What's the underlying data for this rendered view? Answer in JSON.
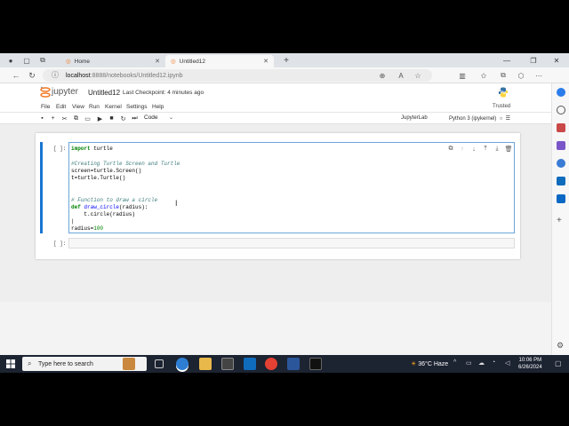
{
  "browser": {
    "tabs": [
      {
        "label": "Home",
        "active": false
      },
      {
        "label": "Untitled12",
        "active": true
      }
    ],
    "new_tab": "+",
    "url_host": "localhost",
    "url_path": ":8888/notebooks/Untitled12.ipynb"
  },
  "jupyter": {
    "brand": "jupyter",
    "notebook_name": "Untitled12",
    "checkpoint": "Last Checkpoint: 4 minutes ago",
    "trusted": "Trusted",
    "menus": [
      "File",
      "Edit",
      "View",
      "Run",
      "Kernel",
      "Settings",
      "Help"
    ],
    "cell_type": "Code",
    "jupyterlab_link": "JupyterLab",
    "kernel_name": "Python 3 (ipykernel)"
  },
  "cells": {
    "cell1_prompt": "[ ]:",
    "cell2_prompt": "[ ]:",
    "code": {
      "l1_kw": "import",
      "l1_rest": " turtle",
      "l3": "#Creating Turtle Screen and Turtle",
      "l4": "screen=turtle.Screen()",
      "l5": "t=turtle.Turtle()",
      "l8": "# Function to draw a circle",
      "l9_kw": "def",
      "l9_fn": " draw_circle",
      "l9_rest": "(radius):",
      "l10": "    t.circle(radius)",
      "l11": "|",
      "l12_a": "radius=",
      "l12_b": "100"
    }
  },
  "taskbar": {
    "search_placeholder": "Type here to search",
    "weather": "36°C  Haze",
    "time": "10:06 PM",
    "date": "6/26/2024"
  },
  "colors": {
    "accent": "#1976d2",
    "taskbar": "#1c2331",
    "jupyter_orange": "#f37726"
  }
}
